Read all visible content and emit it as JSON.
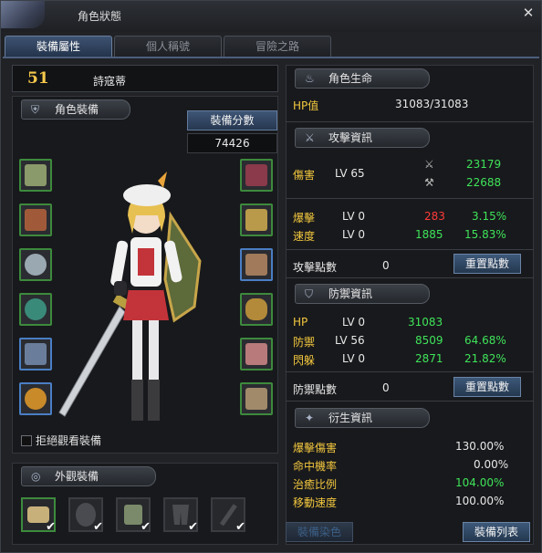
{
  "window": {
    "title": "角色狀態",
    "close_glyph": "✕"
  },
  "tabs": [
    {
      "label": "裝備屬性",
      "active": true
    },
    {
      "label": "個人稱號",
      "active": false
    },
    {
      "label": "冒險之路",
      "active": false
    }
  ],
  "character": {
    "level": "51",
    "name": "詩寇蒂"
  },
  "equipment": {
    "header": "角色裝備",
    "score_label": "裝備分數",
    "score_value": "74426",
    "hide_toggle_label": "拒絕觀看裝備",
    "left_slots": [
      {
        "icon": "armor-shoulder-icon",
        "color": "#8a9a6a",
        "border": "green"
      },
      {
        "icon": "belt-icon",
        "color": "#a05a3a",
        "border": "green"
      },
      {
        "icon": "eye-ring-icon",
        "color": "#9aa8b2",
        "border": "green"
      },
      {
        "icon": "gem-icon",
        "color": "#3a8a7a",
        "border": "green"
      },
      {
        "icon": "necklace-icon",
        "color": "#6a7e9c",
        "border": "blue"
      },
      {
        "icon": "ring-icon",
        "color": "#c98a2a",
        "border": "blue"
      }
    ],
    "right_slots": [
      {
        "icon": "hat-icon",
        "color": "#8a3a4a",
        "border": "green"
      },
      {
        "icon": "top-armor-icon",
        "color": "#b89a4a",
        "border": "green"
      },
      {
        "icon": "pants-icon",
        "color": "#a07a5a",
        "border": "blue"
      },
      {
        "icon": "belt-buckle-icon",
        "color": "#b38a3a",
        "border": "green"
      },
      {
        "icon": "glove-icon",
        "color": "#b87a7a",
        "border": "green"
      },
      {
        "icon": "boots-icon",
        "color": "#a08a6a",
        "border": "green"
      }
    ]
  },
  "appearance": {
    "header": "外觀裝備",
    "slots": [
      {
        "icon": "costume-hat-icon",
        "selected": true
      },
      {
        "icon": "mask-icon",
        "selected": false
      },
      {
        "icon": "costume-top-icon",
        "selected": false
      },
      {
        "icon": "costume-pants-icon",
        "selected": false
      },
      {
        "icon": "costume-weapon-icon",
        "selected": false
      }
    ]
  },
  "life": {
    "header": "角色生命",
    "hp_label": "HP值",
    "hp_value": "31083/31083"
  },
  "attack": {
    "header": "攻擊資訊",
    "damage_label": "傷害",
    "damage_level": "LV 65",
    "damage_a": "23179",
    "damage_b": "22688",
    "crit_label": "爆擊",
    "crit_level": "LV 0",
    "crit_value": "283",
    "crit_pct": "3.15%",
    "speed_label": "速度",
    "speed_level": "LV 0",
    "speed_value": "1885",
    "speed_pct": "15.83%",
    "points_label": "攻擊點數",
    "points_value": "0",
    "reset_label": "重置點數"
  },
  "defense": {
    "header": "防禦資訊",
    "hp_label": "HP",
    "hp_level": "LV 0",
    "hp_value": "31083",
    "def_label": "防禦",
    "def_level": "LV 56",
    "def_value": "8509",
    "def_pct": "64.68%",
    "dodge_label": "閃躲",
    "dodge_level": "LV 0",
    "dodge_value": "2871",
    "dodge_pct": "21.82%",
    "points_label": "防禦點數",
    "points_value": "0",
    "reset_label": "重置點數"
  },
  "derived": {
    "header": "衍生資訊",
    "rows": [
      {
        "label": "爆擊傷害",
        "value": "130.00%",
        "color": "#e8e8e8"
      },
      {
        "label": "命中機率",
        "value": "0.00%",
        "color": "#e8e8e8"
      },
      {
        "label": "治癒比例",
        "value": "104.00%",
        "color": "#3fe45a"
      },
      {
        "label": "移動速度",
        "value": "100.00%",
        "color": "#e8e8e8"
      }
    ]
  },
  "footer": {
    "dye_label": "裝備染色",
    "list_label": "裝備列表"
  }
}
